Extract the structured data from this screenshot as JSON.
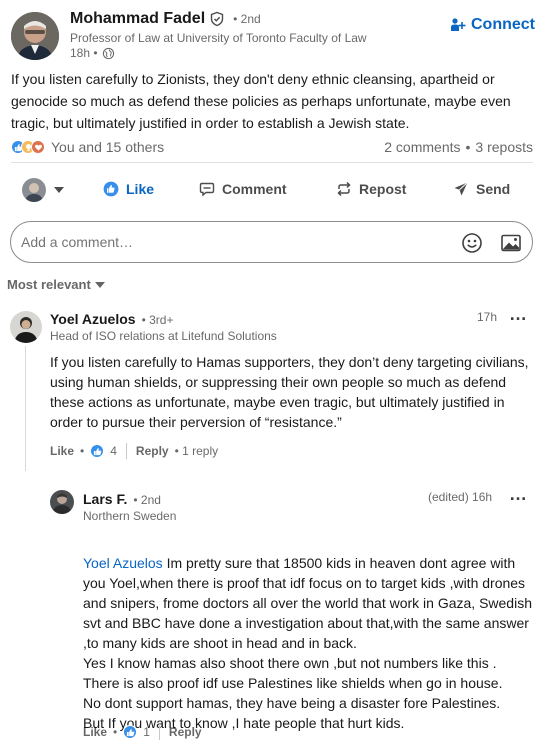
{
  "post": {
    "author": {
      "name": "Mohammad Fadel",
      "degree": "• 2nd",
      "headline": "Professor of Law at University of Toronto Faculty of Law",
      "time": "18h •"
    },
    "connect_label": "Connect",
    "body": "If you listen carefully to Zionists, they don't deny ethnic cleansing, apartheid or genocide so much as defend these policies as perhaps unfortunate, maybe even tragic, but ultimately justified in order to establish a Jewish state.",
    "reactions_text": "You and 15 others",
    "comments_count": "2 comments",
    "reposts_count": "3 reposts",
    "separator": "•"
  },
  "actions": {
    "like": "Like",
    "comment": "Comment",
    "repost": "Repost",
    "send": "Send"
  },
  "comment_box": {
    "placeholder": "Add a comment…"
  },
  "sort_label": "Most relevant",
  "comments": [
    {
      "name": "Yoel Azuelos",
      "degree": "• 3rd+",
      "headline": "Head of ISO relations at Litefund Solutions",
      "time": "17h",
      "text": "If you listen carefully to Hamas supporters, they don’t deny targeting civilians, using human shields, or suppressing their own people so much as defend these actions as unfortunate, maybe even tragic, but ultimately justified in order to pursue their perversion of “resistance.”",
      "like_label": "Like",
      "like_sep": "•",
      "like_count": "4",
      "reply_label": "Reply",
      "reply_count": "• 1 reply"
    }
  ],
  "reply": {
    "name": "Lars F.",
    "degree": "• 2nd",
    "headline": "Northern Sweden",
    "time": "(edited) 16h",
    "mention": "Yoel Azuelos",
    "text": "Im pretty sure that 18500 kids in heaven dont agree with you Yoel,when there is proof that idf focus on to target kids ,with drones and snipers, frome doctors all over the world that work in Gaza, Swedish svt and BBC have done a investigation about that,with the same answer ,to many kids are shoot in head and in back.\nYes I know hamas also shoot there own ,but not numbers like this .\nThere is also proof idf use Palestines like shields when go in house.\nNo dont support hamas, they have being a disaster fore Palestines.\nBut If you want to know ,I hate people that hurt kids.",
    "like_label": "Like",
    "like_sep": "•",
    "like_count": "1",
    "reply_label": "Reply"
  },
  "more_icon": "…",
  "colors": {
    "brand_blue": "#0a66c2",
    "like_blue": "#378fe9",
    "text_muted": "rgba(0,0,0,0.6)"
  }
}
